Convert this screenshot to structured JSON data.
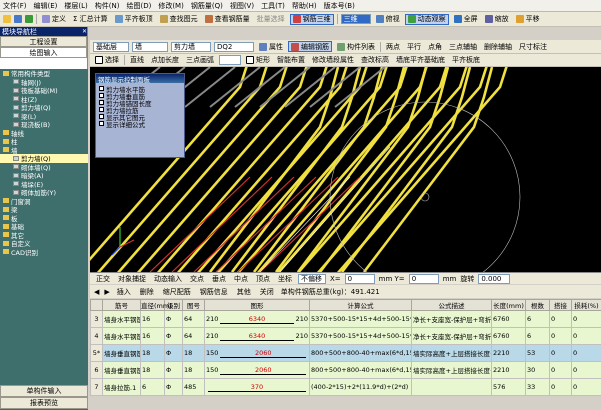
{
  "menu": [
    "文件(F)",
    "编辑(E)",
    "楼层(L)",
    "构件(N)",
    "绘图(D)",
    "修改(M)",
    "钢筋量(Q)",
    "视图(V)",
    "工具(T)",
    "帮助(H)",
    "版本号(B)"
  ],
  "toolbar1": {
    "items": [
      "定义",
      "Σ 汇总计算",
      "平齐板顶",
      "查找图元",
      "查看钢筋量",
      "批量选择",
      "钢筋三维"
    ],
    "view_select": "三维",
    "right_items": [
      "俯视",
      "动态观察",
      "全屏",
      "缩放",
      "平移"
    ]
  },
  "toolbar2": {
    "layer_select": "基础层",
    "cat_select": "墙",
    "type_select": "剪力墙",
    "name_select": "DQ2",
    "items": [
      "属性",
      "编辑钢筋",
      "构件列表"
    ],
    "right_items": [
      "两点",
      "平行",
      "点角",
      "三点辅轴",
      "删除辅轴",
      "尺寸标注"
    ]
  },
  "toolbar3": {
    "items": [
      "选择",
      "直线",
      "点加长度",
      "三点画弧",
      "矩形",
      "智能布置",
      "修改墙段属性",
      "查改标高",
      "墙底平齐基础底",
      "平齐板底"
    ]
  },
  "nav": {
    "title": "模块导航栏",
    "btn1": "工程设置",
    "btn2": "绘图输入",
    "tree": [
      {
        "label": "常用构件类型",
        "level": 0,
        "type": "folder"
      },
      {
        "label": "轴网(J)",
        "level": 1,
        "type": "item"
      },
      {
        "label": "筏板基础(M)",
        "level": 1,
        "type": "item"
      },
      {
        "label": "柱(Z)",
        "level": 1,
        "type": "item"
      },
      {
        "label": "剪力墙(Q)",
        "level": 1,
        "type": "item"
      },
      {
        "label": "梁(L)",
        "level": 1,
        "type": "item"
      },
      {
        "label": "现浇板(B)",
        "level": 1,
        "type": "item"
      },
      {
        "label": "轴线",
        "level": 0,
        "type": "folder"
      },
      {
        "label": "柱",
        "level": 0,
        "type": "folder"
      },
      {
        "label": "墙",
        "level": 0,
        "type": "folder"
      },
      {
        "label": "剪力墙(Q)",
        "level": 1,
        "type": "item",
        "selected": true
      },
      {
        "label": "砌体墙(Q)",
        "level": 1,
        "type": "item"
      },
      {
        "label": "暗梁(A)",
        "level": 1,
        "type": "item"
      },
      {
        "label": "墙垛(E)",
        "level": 1,
        "type": "item"
      },
      {
        "label": "砌体加筋(Y)",
        "level": 1,
        "type": "item"
      },
      {
        "label": "门窗洞",
        "level": 0,
        "type": "folder"
      },
      {
        "label": "梁",
        "level": 0,
        "type": "folder"
      },
      {
        "label": "板",
        "level": 0,
        "type": "folder"
      },
      {
        "label": "基础",
        "level": 0,
        "type": "folder"
      },
      {
        "label": "其它",
        "level": 0,
        "type": "folder"
      },
      {
        "label": "自定义",
        "level": 0,
        "type": "folder"
      },
      {
        "label": "CAD识别",
        "level": 0,
        "type": "folder"
      }
    ],
    "bottom1": "单构件输入",
    "bottom2": "报表预览"
  },
  "panel": {
    "title": "钢筋显示控制面板",
    "checks": [
      "剪力墙水平筋",
      "剪力墙垂直筋",
      "剪力墙锚固长度",
      "剪力墙拉筋",
      "显示其它图元",
      "显示详细公式"
    ]
  },
  "snapbar": {
    "items": [
      "正交",
      "对象捕捉",
      "动态输入",
      "交点",
      "垂点",
      "中点",
      "顶点",
      "坐标",
      "不偏移"
    ],
    "x_label": "X=",
    "x_value": "0",
    "y_label": "mm Y=",
    "y_value": "0",
    "rot_label": "mm",
    "rotate": "旋转",
    "rot_value": "0.000"
  },
  "gridtb": {
    "items": [
      "插入",
      "删除",
      "缩尺配筋",
      "钢筋信息",
      "其他",
      "关闭"
    ],
    "total_label": "单构件钢筋总重(kg)：491.421"
  },
  "table": {
    "headers": [
      "",
      "筋号",
      "直径(mm)",
      "级别",
      "图号",
      "图形",
      "计算公式",
      "公式描述",
      "长度(mm)",
      "根数",
      "搭接",
      "损耗(%)"
    ],
    "rows": [
      {
        "no": "3",
        "name": "墙身水平钢筋.3",
        "dia": "16",
        "grade": "Φ",
        "fig": "64",
        "len_l": "210",
        "len_m": "6340",
        "len_r": "210",
        "formula": "5370+500-15*15+4d+500-15*15+4d",
        "desc": "净长+支座宽-保护层+弯折+支座宽-保护层+弯折",
        "length": "6760",
        "count": "6",
        "lap": "0",
        "loss": "0",
        "style": "g"
      },
      {
        "no": "4",
        "name": "墙身水平钢筋.4",
        "dia": "16",
        "grade": "Φ",
        "fig": "64",
        "len_l": "210",
        "len_m": "6340",
        "len_r": "210",
        "formula": "5370+500-15*15+4d+500-15*15+4d",
        "desc": "净长+支座宽-保护层+弯折+支座宽-保护层+弯折",
        "length": "6760",
        "count": "6",
        "lap": "0",
        "loss": "0",
        "style": "g"
      },
      {
        "no": "5*",
        "name": "墙身垂直钢筋.1",
        "dia": "18",
        "grade": "Φ",
        "fig": "18",
        "len_l": "150",
        "len_m": "2060",
        "len_r": "",
        "formula": "800+500+800-40+max(6*d,150)",
        "desc": "墙实际高度+上层搭接长度+节点高-保护层+弯折",
        "length": "2210",
        "count": "53",
        "lap": "0",
        "loss": "0",
        "style": "s"
      },
      {
        "no": "6",
        "name": "墙身垂直钢筋.2",
        "dia": "18",
        "grade": "Φ",
        "fig": "18",
        "len_l": "150",
        "len_m": "2060",
        "len_r": "",
        "formula": "800+500+800-40+max(6*d,150)",
        "desc": "墙实际高度+上层搭接长度+节点高-保护层+弯折",
        "length": "2210",
        "count": "30",
        "lap": "0",
        "loss": "0",
        "style": "g"
      },
      {
        "no": "7",
        "name": "墙身拉筋.1",
        "dia": "6",
        "grade": "Φ",
        "fig": "485",
        "len_l": "",
        "len_m": "370",
        "len_r": "",
        "formula": "(400-2*15)+2*(11.9*d)+(2*d)",
        "desc": "",
        "length": "576",
        "count": "33",
        "lap": "0",
        "loss": "0",
        "style": "g"
      }
    ]
  },
  "colors": {
    "rebar": "#f0e040",
    "canvas": "#000000",
    "grid_green": "#e8f7d0",
    "grid_sel": "#b9d8e8"
  }
}
